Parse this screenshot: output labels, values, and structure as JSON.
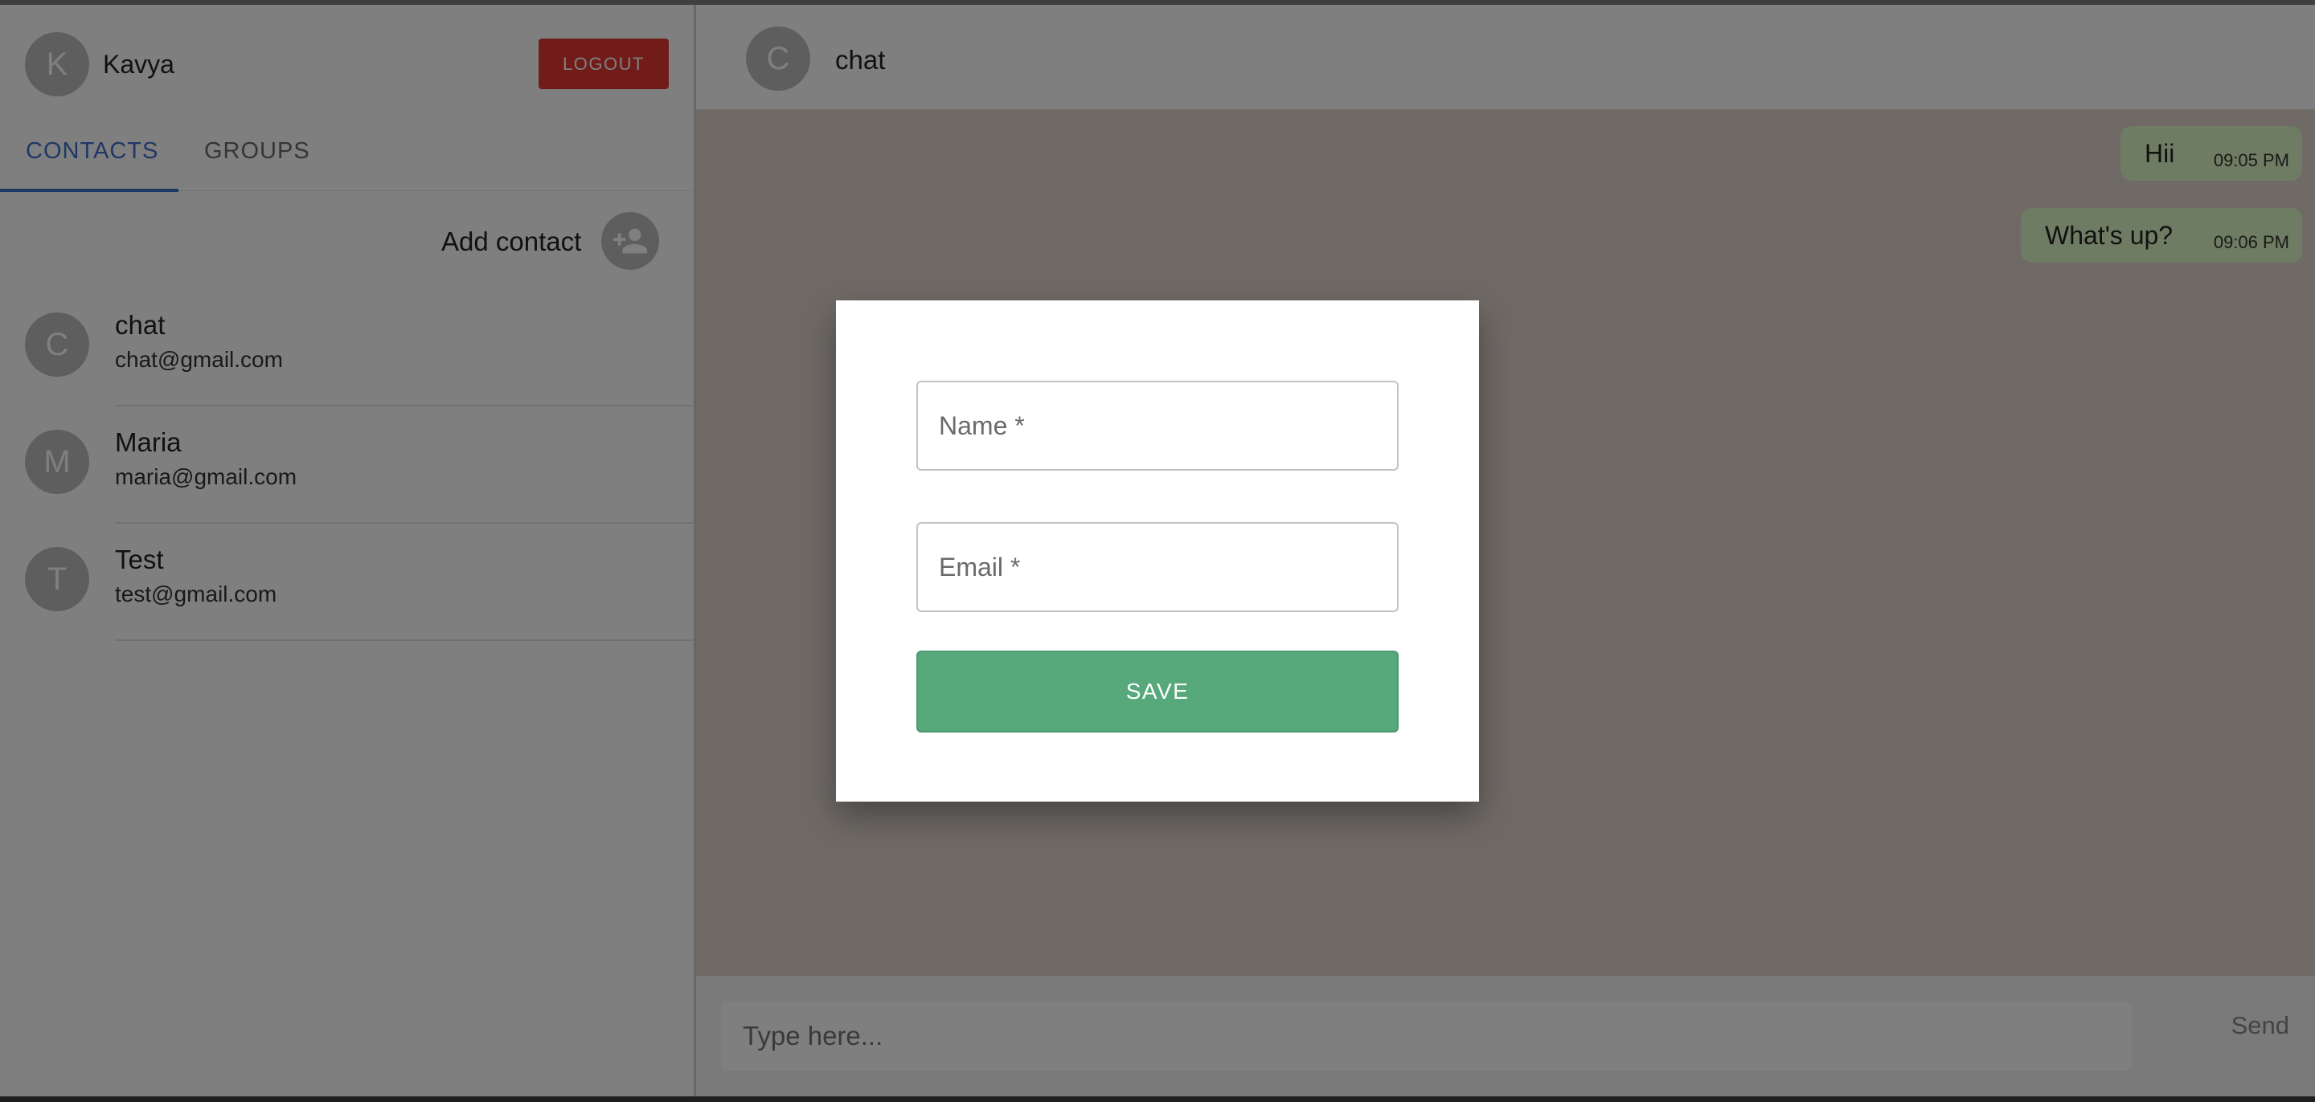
{
  "user": {
    "avatar_initial": "K",
    "name": "Kavya"
  },
  "toolbar": {
    "logout_label": "LOGOUT"
  },
  "tabs": [
    {
      "label": "CONTACTS",
      "active": true
    },
    {
      "label": "GROUPS",
      "active": false
    }
  ],
  "add_contact": {
    "label": "Add contact",
    "icon": "person-add-icon"
  },
  "contacts": [
    {
      "initial": "C",
      "name": "chat",
      "email": "chat@gmail.com"
    },
    {
      "initial": "M",
      "name": "Maria",
      "email": "maria@gmail.com"
    },
    {
      "initial": "T",
      "name": "Test",
      "email": "test@gmail.com"
    }
  ],
  "chat": {
    "avatar_initial": "C",
    "title": "chat",
    "messages": [
      {
        "text": "Hii",
        "time": "09:05 PM"
      },
      {
        "text": "What's up?",
        "time": "09:06 PM"
      }
    ],
    "composer_placeholder": "Type here...",
    "send_label": "Send"
  },
  "dialog": {
    "name_placeholder": "Name *",
    "email_placeholder": "Email *",
    "save_label": "SAVE"
  },
  "colors": {
    "accent": "#3f6fcf",
    "logout": "#e53935",
    "save": "#57a97c",
    "bubble": "#dcf8c6",
    "chat_bg": "#dfd5cc"
  }
}
